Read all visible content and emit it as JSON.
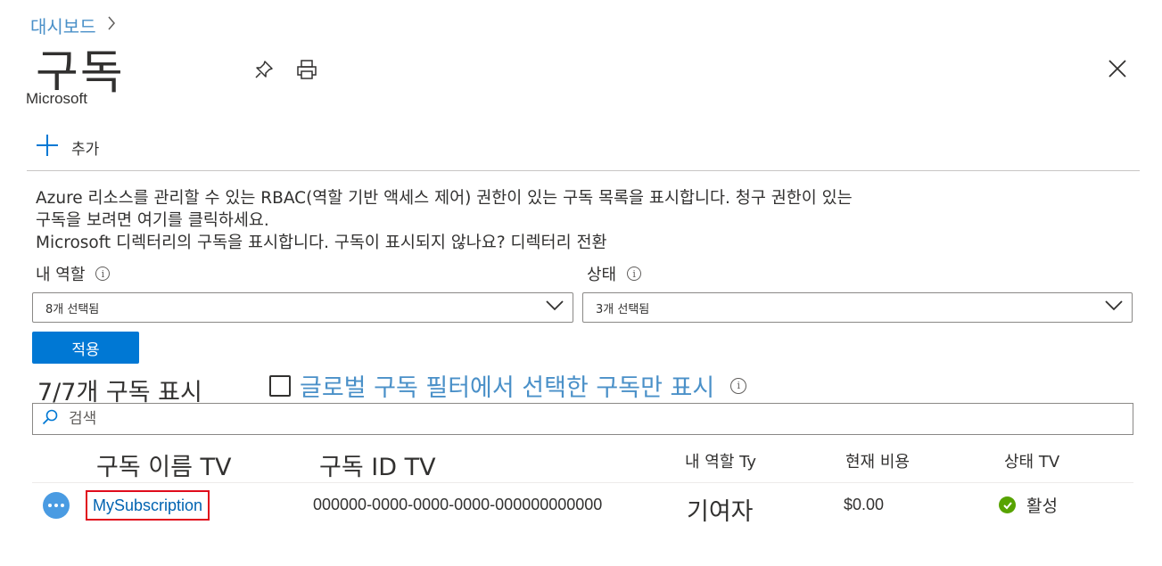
{
  "breadcrumb": {
    "home": "대시보드"
  },
  "header": {
    "title": "구독",
    "subtitle": "Microsoft"
  },
  "toolbar": {
    "add_label": "추가"
  },
  "description": {
    "line1": "Azure 리소스를 관리할 수 있는 RBAC(역할 기반 액세스 제어) 권한이 있는 구독 목록을 표시합니다. 청구 권한이 있는",
    "line2": "구독을 보려면 여기를 클릭하세요.",
    "line3": "Microsoft 디렉터리의 구독을 표시합니다. 구독이 표시되지 않나요? 디렉터리 전환"
  },
  "filters": {
    "role_label": "내 역할",
    "role_value": "8개 선택됨",
    "status_label": "상태",
    "status_value": "3개 선택됨",
    "apply_label": "적용"
  },
  "summary": {
    "count_text": "7/7개 구독 표시",
    "global_filter_label": "글로벌 구독 필터에서 선택한 구독만 표시"
  },
  "search": {
    "placeholder": "검색"
  },
  "table": {
    "headers": {
      "name": "구독 이름 TV",
      "id": "구독 ID TV",
      "role": "내 역할 Ty",
      "cost": "현재 비용",
      "status": "상태 TV"
    },
    "rows": [
      {
        "name": "MySubscription",
        "id": "000000-0000-0000-0000-000000000000",
        "role": "기여자",
        "cost": "$0.00",
        "status": "활성"
      }
    ]
  },
  "colors": {
    "accent": "#0078d4",
    "link": "#0063b1",
    "highlight": "#e00b1c",
    "success": "#57a300"
  },
  "icons": [
    "chevron-right-icon",
    "pin-icon",
    "print-icon",
    "close-icon",
    "plus-icon",
    "info-icon",
    "chevron-down-icon",
    "search-icon",
    "more-icon",
    "check-circle-icon"
  ]
}
